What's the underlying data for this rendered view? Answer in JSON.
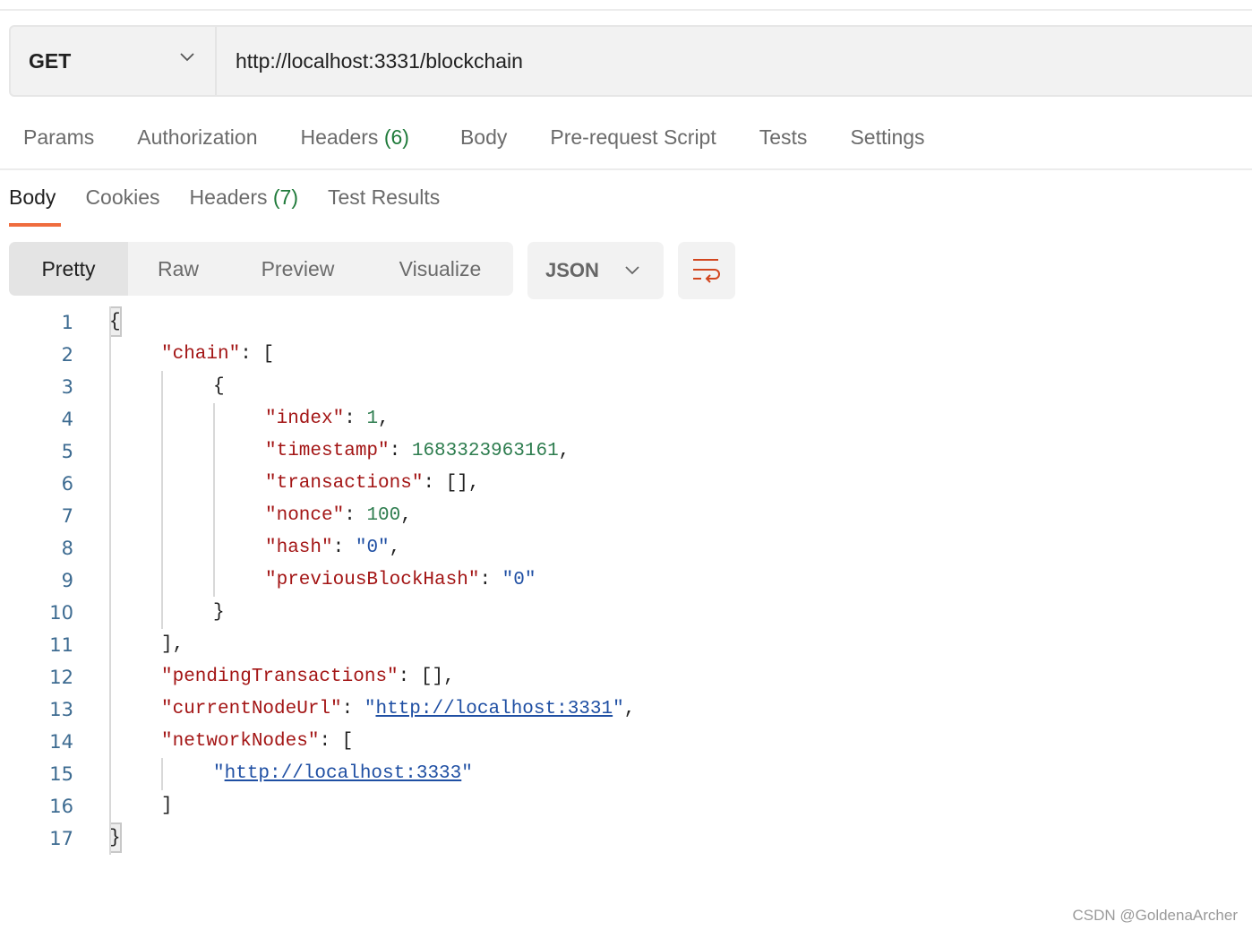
{
  "request": {
    "method": "GET",
    "url": "http://localhost:3331/blockchain"
  },
  "request_tabs": [
    {
      "label": "Params"
    },
    {
      "label": "Authorization"
    },
    {
      "label": "Headers",
      "count": "(6)"
    },
    {
      "label": "Body"
    },
    {
      "label": "Pre-request Script"
    },
    {
      "label": "Tests"
    },
    {
      "label": "Settings"
    }
  ],
  "response_tabs": [
    {
      "label": "Body",
      "active": true
    },
    {
      "label": "Cookies"
    },
    {
      "label": "Headers",
      "count": "(7)"
    },
    {
      "label": "Test Results"
    }
  ],
  "view_modes": [
    {
      "label": "Pretty",
      "selected": true
    },
    {
      "label": "Raw"
    },
    {
      "label": "Preview"
    },
    {
      "label": "Visualize"
    }
  ],
  "format": "JSON",
  "icons": {
    "method_dropdown": "chevron-down-icon",
    "format_dropdown": "chevron-down-icon",
    "wrap": "wrap-lines-icon"
  },
  "colors": {
    "accent": "#ef6c3e",
    "key": "#a31515",
    "number": "#2e7d4f",
    "string": "#1f4fa3"
  },
  "code_lines": [
    {
      "n": "1",
      "i": 0,
      "t": [
        [
          "p",
          "{"
        ]
      ]
    },
    {
      "n": "2",
      "i": 1,
      "t": [
        [
          "k",
          "\"chain\""
        ],
        [
          "p",
          ": ["
        ]
      ]
    },
    {
      "n": "3",
      "i": 2,
      "t": [
        [
          "p",
          "{"
        ]
      ]
    },
    {
      "n": "4",
      "i": 3,
      "t": [
        [
          "k",
          "\"index\""
        ],
        [
          "p",
          ": "
        ],
        [
          "n",
          "1"
        ],
        [
          "p",
          ","
        ]
      ]
    },
    {
      "n": "5",
      "i": 3,
      "t": [
        [
          "k",
          "\"timestamp\""
        ],
        [
          "p",
          ": "
        ],
        [
          "n",
          "1683323963161"
        ],
        [
          "p",
          ","
        ]
      ]
    },
    {
      "n": "6",
      "i": 3,
      "t": [
        [
          "k",
          "\"transactions\""
        ],
        [
          "p",
          ": [],"
        ]
      ]
    },
    {
      "n": "7",
      "i": 3,
      "t": [
        [
          "k",
          "\"nonce\""
        ],
        [
          "p",
          ": "
        ],
        [
          "n",
          "100"
        ],
        [
          "p",
          ","
        ]
      ]
    },
    {
      "n": "8",
      "i": 3,
      "t": [
        [
          "k",
          "\"hash\""
        ],
        [
          "p",
          ": "
        ],
        [
          "s",
          "\"0\""
        ],
        [
          "p",
          ","
        ]
      ]
    },
    {
      "n": "9",
      "i": 3,
      "t": [
        [
          "k",
          "\"previousBlockHash\""
        ],
        [
          "p",
          ": "
        ],
        [
          "s",
          "\"0\""
        ]
      ]
    },
    {
      "n": "10",
      "i": 2,
      "t": [
        [
          "p",
          "}"
        ]
      ]
    },
    {
      "n": "11",
      "i": 1,
      "t": [
        [
          "p",
          "],"
        ]
      ]
    },
    {
      "n": "12",
      "i": 1,
      "t": [
        [
          "k",
          "\"pendingTransactions\""
        ],
        [
          "p",
          ": [],"
        ]
      ]
    },
    {
      "n": "13",
      "i": 1,
      "t": [
        [
          "k",
          "\"currentNodeUrl\""
        ],
        [
          "p",
          ": "
        ],
        [
          "s",
          "\""
        ],
        [
          "u",
          "http://localhost:3331"
        ],
        [
          "s",
          "\""
        ],
        [
          "p",
          ","
        ]
      ]
    },
    {
      "n": "14",
      "i": 1,
      "t": [
        [
          "k",
          "\"networkNodes\""
        ],
        [
          "p",
          ": ["
        ]
      ]
    },
    {
      "n": "15",
      "i": 2,
      "t": [
        [
          "s",
          "\""
        ],
        [
          "u",
          "http://localhost:3333"
        ],
        [
          "s",
          "\""
        ]
      ]
    },
    {
      "n": "16",
      "i": 1,
      "t": [
        [
          "p",
          "]"
        ]
      ]
    },
    {
      "n": "17",
      "i": 0,
      "t": [
        [
          "p",
          "}"
        ]
      ]
    }
  ],
  "watermark": "CSDN @GoldenaArcher"
}
